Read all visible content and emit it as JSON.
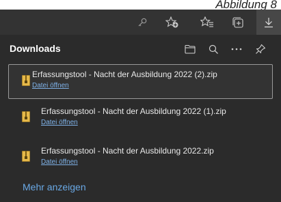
{
  "caption": "Abbildung 8",
  "toolbar": {
    "icons": [
      "key-icon",
      "add-favorite-icon",
      "favorites-icon",
      "collections-icon",
      "downloads-icon"
    ]
  },
  "panel": {
    "title": "Downloads",
    "header_icons": [
      "folder-icon",
      "search-icon",
      "more-icon",
      "pin-icon"
    ],
    "items": [
      {
        "name": "Erfassungstool - Nacht der Ausbildung 2022 (2).zip",
        "action": "Datei öffnen"
      },
      {
        "name": "Erfassungstool - Nacht der Ausbildung 2022 (1).zip",
        "action": "Datei öffnen"
      },
      {
        "name": "Erfassungstool - Nacht der Ausbildung 2022.zip",
        "action": "Datei öffnen"
      }
    ],
    "show_more": "Mehr anzeigen"
  },
  "colors": {
    "panel_bg": "#2b2b2b",
    "toolbar_bg": "#333333",
    "link": "#7fb2e8",
    "zip_icon": "#e6b94a"
  }
}
